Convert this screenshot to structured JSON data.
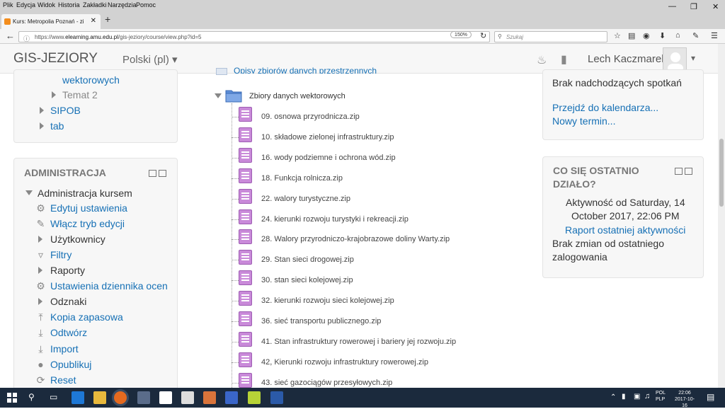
{
  "browser": {
    "menu": [
      "Plik",
      "Edycja",
      "Widok",
      "Historia",
      "Zakładki",
      "Narzędzia",
      "Pomoc"
    ],
    "tab_title": "Kurs: Metropolia Poznań - zi",
    "url_prefix": "https://www.",
    "url_domain": "elearning.amu.edu.pl",
    "url_path": "/gis-jeziory/course/view.php?id=5",
    "zoom": "150%",
    "search_placeholder": "Szukaj"
  },
  "header": {
    "site_name": "GIS-JEZIORY",
    "language": "Polski (pl) ▾",
    "user_name": "Lech Kaczmarek"
  },
  "nav_block": {
    "items": [
      {
        "label": "wektorowych"
      },
      {
        "label": "Temat 2"
      },
      {
        "label": "SIPOB"
      },
      {
        "label": "tab"
      }
    ]
  },
  "admin_block": {
    "title": "ADMINISTRACJA",
    "course_admin": "Administracja kursem",
    "items": [
      {
        "label": "Edytuj ustawienia",
        "icon": "gear-icon"
      },
      {
        "label": "Włącz tryb edycji",
        "icon": "pencil-icon"
      },
      {
        "label": "Użytkownicy",
        "icon": "arrow-icon"
      },
      {
        "label": "Filtry",
        "icon": "filter-icon"
      },
      {
        "label": "Raporty",
        "icon": "arrow-icon"
      },
      {
        "label": "Ustawienia dziennika ocen",
        "icon": "gear-icon"
      },
      {
        "label": "Odznaki",
        "icon": "arrow-icon"
      },
      {
        "label": "Kopia zapasowa",
        "icon": "upload-icon"
      },
      {
        "label": "Odtwórz",
        "icon": "download-icon"
      },
      {
        "label": "Import",
        "icon": "import-icon"
      },
      {
        "label": "Opublikuj",
        "icon": "globe-icon"
      },
      {
        "label": "Reset",
        "icon": "reset-icon"
      }
    ]
  },
  "course": {
    "partial_heading": "Opisy zbiorów danych przestrzennych",
    "folder_name": "Zbiory danych wektorowych",
    "files": [
      "09. osnowa przyrodnicza.zip",
      "10. składowe zielonej infrastruktury.zip",
      "16. wody podziemne i ochrona wód.zip",
      "18. Funkcja rolnicza.zip",
      "22. walory turystyczne.zip",
      "24. kierunki rozwoju turystyki i rekreacji.zip",
      "28. Walory przyrodniczo-krajobrazowe doliny Warty.zip",
      "29. Stan sieci drogowej.zip",
      "30. stan sieci kolejowej.zip",
      "32. kierunki rozwoju sieci kolejowej.zip",
      "36. sieć transportu publicznego.zip",
      "41. Stan infrastruktury rowerowej i bariery jej rozwoju.zip",
      "42, Kierunki rozwoju infrastruktury rowerowej.zip",
      "43. sieć gazociągów przesyłowych.zip"
    ]
  },
  "events_block": {
    "no_events": "Brak nadchodzących spotkań",
    "go_calendar": "Przejdź do kalendarza...",
    "new_event": "Nowy termin..."
  },
  "activity_block": {
    "title_line1": "CO SIĘ OSTATNIO",
    "title_line2": "DZIAŁO?",
    "since_line1": "Aktywność od Saturday, 14",
    "since_line2": "October 2017, 22:06 PM",
    "report_link": "Raport ostatniej aktywności",
    "no_changes_line1": "Brak zmian od ostatniego",
    "no_changes_line2": "zalogowania"
  },
  "taskbar": {
    "lang1": "POL",
    "lang2": "PLP",
    "time": "22:06",
    "date": "2017-10-16"
  }
}
